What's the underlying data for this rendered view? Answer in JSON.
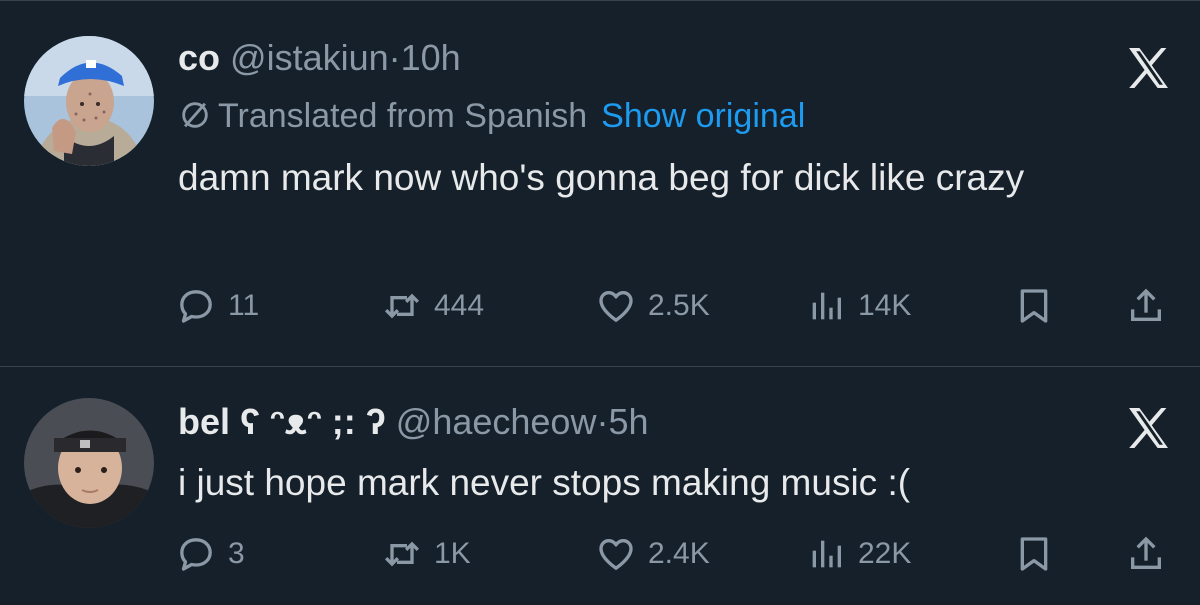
{
  "tweets": [
    {
      "name": "co",
      "handle": "@istakiun",
      "separator": "·",
      "time": "10h",
      "translated_label": "Translated from Spanish",
      "show_original_label": "Show original",
      "text": "damn mark now who's gonna beg for dick like crazy",
      "replies": "11",
      "retweets": "444",
      "likes": "2.5K",
      "views": "14K"
    },
    {
      "name": "bel ʕ ᵔᴥᵔ ;: ʔ",
      "handle": "@haecheow",
      "separator": "·",
      "time": "5h",
      "text": "i just hope mark never stops making music :(",
      "replies": "3",
      "retweets": "1K",
      "likes": "2.4K",
      "views": "22K"
    }
  ],
  "icons": {
    "reply": "reply-icon",
    "retweet": "retweet-icon",
    "like": "heart-icon",
    "views": "views-icon",
    "bookmark": "bookmark-icon",
    "share": "share-icon",
    "brand": "x-logo-icon",
    "translate": "translate-icon"
  },
  "colors": {
    "background": "#15202b",
    "text": "#e7e9ea",
    "secondary": "#8b98a5",
    "link": "#1d9bf0",
    "divider": "#38444d"
  }
}
